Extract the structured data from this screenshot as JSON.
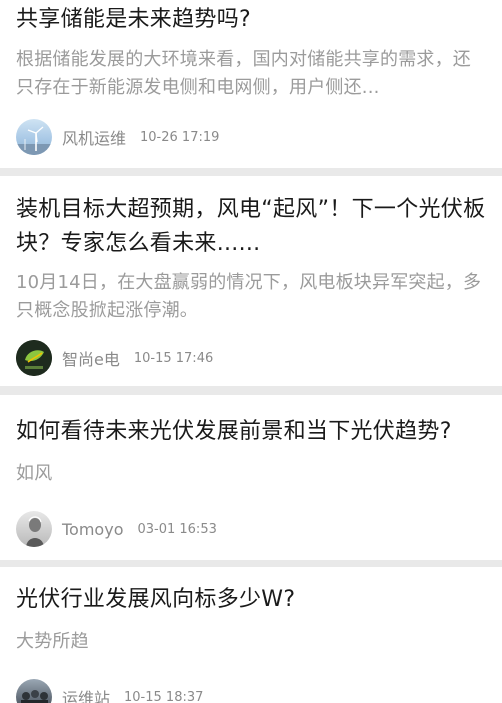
{
  "feed": {
    "items": [
      {
        "title": "共享储能是未来趋势吗?",
        "summary": "根据储能发展的大环境来看，国内对储能共享的需求，还只存在于新能源发电侧和电网侧，用户侧还...",
        "author": "风机运维",
        "time": "10-26 17:19",
        "avatar_icon": "wind-turbine-avatar"
      },
      {
        "title": "装机目标大超预期，风电“起风”！下一个光伏板块？专家怎么看未来......",
        "summary": "10月14日，在大盘赢弱的情况下，风电板块异军突起，多只概念股掀起涨停潮。",
        "author": "智尚e电",
        "time": "10-15 17:46",
        "avatar_icon": "leaf-logo-avatar"
      },
      {
        "title": "如何看待未来光伏发展前景和当下光伏趋势?",
        "summary": "如风",
        "author": "Tomoyo",
        "time": "03-01 16:53",
        "avatar_icon": "figure-avatar"
      },
      {
        "title": "光伏行业发展风向标多少W?",
        "summary": "大势所趋",
        "author": "运维站",
        "time": "10-15 18:37",
        "avatar_icon": "group-photo-avatar"
      }
    ]
  }
}
